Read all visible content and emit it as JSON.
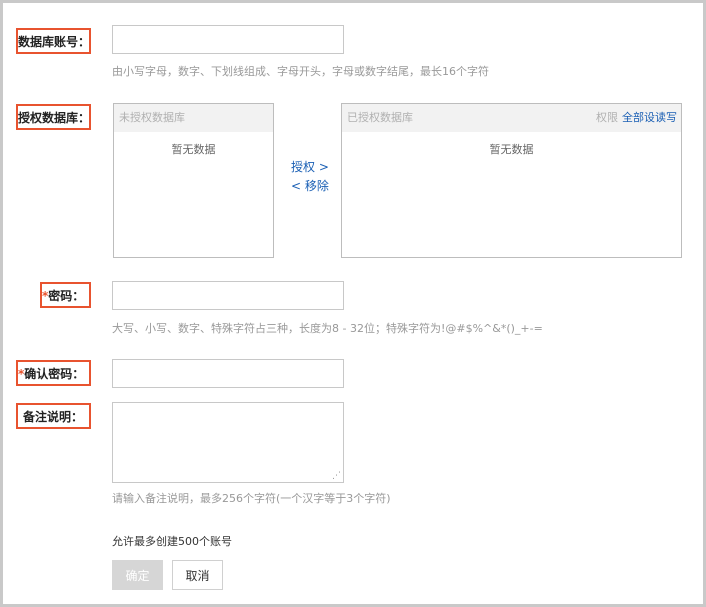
{
  "account": {
    "label": "数据库账号：",
    "hint": "由小写字母，数字、下划线组成、字母开头，字母或数字结尾，最长16个字符",
    "value": ""
  },
  "auth": {
    "label": "授权数据库：",
    "left_header": "未授权数据库",
    "left_empty": "暂无数据",
    "grant_link": "授权 >",
    "remove_link": "< 移除",
    "right_header": "已授权数据库",
    "perm_label": "权限",
    "set_all_rw": "全部设读写",
    "right_empty": "暂无数据"
  },
  "password": {
    "required": "*",
    "label": "密码：",
    "hint": "大写、小写、数字、特殊字符占三种，长度为8 - 32位；特殊字符为!@#$%^&*()_+-="
  },
  "confirm": {
    "required": "*",
    "label": "确认密码："
  },
  "remark": {
    "label": "备注说明：",
    "hint": "请输入备注说明，最多256个字符(一个汉字等于3个字符)"
  },
  "footer": {
    "limit_text": "允许最多创建500个账号",
    "ok_label": "确定",
    "cancel_label": "取消"
  }
}
